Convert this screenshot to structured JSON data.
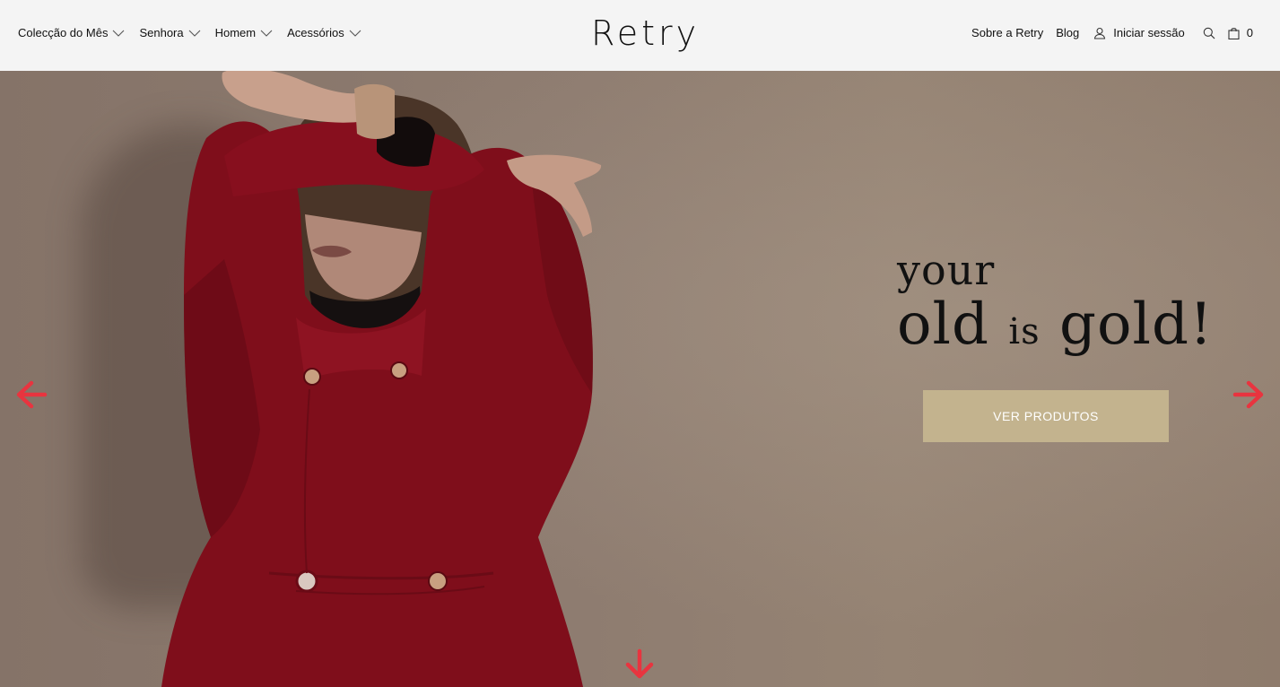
{
  "header": {
    "logo_text": "Retry",
    "nav_left": [
      {
        "label": "Colecção do Mês"
      },
      {
        "label": "Senhora"
      },
      {
        "label": "Homem"
      },
      {
        "label": "Acessórios"
      }
    ],
    "about_label": "Sobre a Retry",
    "blog_label": "Blog",
    "login_label": "Iniciar sessão",
    "cart_count": "0",
    "icons": [
      "user-icon",
      "search-icon",
      "shopping-bag-icon",
      "chevron-down-icon"
    ]
  },
  "hero": {
    "headline_line1": "your",
    "headline_word1": "old",
    "headline_word2": "is",
    "headline_word3": "gold!",
    "cta_label": "VER PRODUTOS",
    "accent_color": "#e8343f",
    "button_color": "#c3b38e",
    "coat_color": "#8a0f1c"
  }
}
